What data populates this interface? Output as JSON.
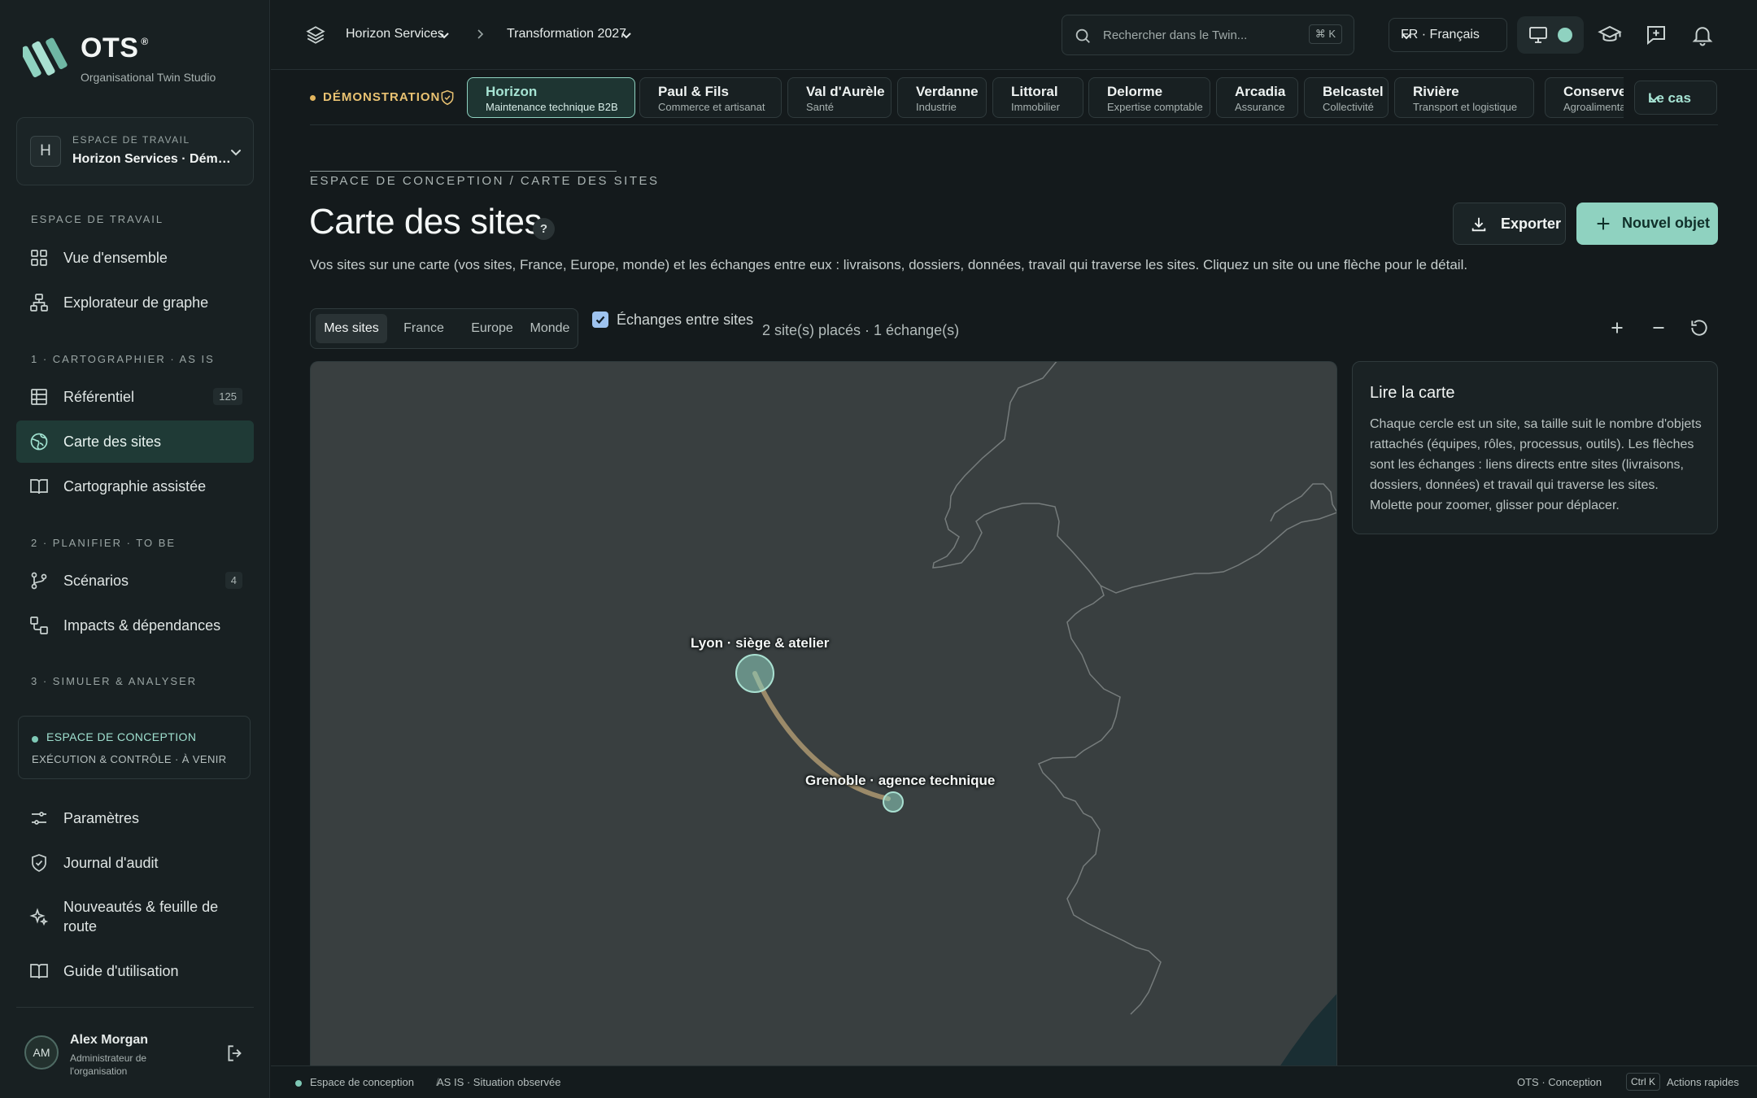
{
  "app": {
    "name": "OTS",
    "registered": "®",
    "subtitle": "Organisational Twin Studio"
  },
  "workspace": {
    "initial": "H",
    "label": "ESPACE DE TRAVAIL",
    "name": "Horizon Services · Démonstration"
  },
  "sidebar": {
    "sections": [
      "ESPACE DE TRAVAIL",
      "1 · CARTOGRAPHIER · AS IS",
      "2 · PLANIFIER · TO BE",
      "3 · SIMULER & ANALYSER"
    ],
    "items": [
      {
        "label": "Vue d'ensemble",
        "icon": "grid-icon"
      },
      {
        "label": "Explorateur de graphe",
        "icon": "graph-icon"
      },
      {
        "label": "Référentiel",
        "icon": "table-icon",
        "badge": "125"
      },
      {
        "label": "Carte des sites",
        "icon": "globe-icon",
        "active": true
      },
      {
        "label": "Cartographie assistée",
        "icon": "book-icon"
      },
      {
        "label": "Scénarios",
        "icon": "branch-icon",
        "badge": "4"
      },
      {
        "label": "Impacts & dépendances",
        "icon": "dependency-icon"
      },
      {
        "label": "Paramètres",
        "icon": "sliders-icon"
      },
      {
        "label": "Journal d'audit",
        "icon": "shield-icon"
      },
      {
        "label": "Nouveautés & feuille de route",
        "icon": "sparkle-icon"
      },
      {
        "label": "Guide d'utilisation",
        "icon": "book-icon"
      }
    ],
    "concept_box": {
      "title": "ESPACE DE CONCEPTION",
      "subtitle": "EXÉCUTION & CONTRÔLE · À VENIR"
    }
  },
  "user": {
    "initials": "AM",
    "name": "Alex Morgan",
    "role": "Administrateur de l'organisation"
  },
  "topbar": {
    "crumb1": "Horizon Services",
    "crumb2": "Transformation 2027",
    "search_placeholder": "Rechercher dans le Twin...",
    "search_shortcut": "⌘ K",
    "language": "FR · Français"
  },
  "demo": {
    "label": "DÉMONSTRATION"
  },
  "cases": [
    {
      "name": "Horizon",
      "sub": "Maintenance technique B2B",
      "active": true
    },
    {
      "name": "Paul & Fils",
      "sub": "Commerce et artisanat"
    },
    {
      "name": "Val d'Aurèle",
      "sub": "Santé"
    },
    {
      "name": "Verdanne",
      "sub": "Industrie"
    },
    {
      "name": "Littoral",
      "sub": "Immobilier"
    },
    {
      "name": "Delorme",
      "sub": "Expertise comptable"
    },
    {
      "name": "Arcadia",
      "sub": "Assurance"
    },
    {
      "name": "Belcastel",
      "sub": "Collectivité"
    },
    {
      "name": "Rivière",
      "sub": "Transport et logistique"
    },
    {
      "name": "Conserverie",
      "sub": "Agroalimentaire"
    }
  ],
  "cases_more": "Le cas",
  "page": {
    "kicker": "ESPACE DE CONCEPTION / CARTE DES SITES",
    "title": "Carte des sites",
    "help": "?",
    "description": "Vos sites sur une carte (vos sites, France, Europe, monde) et les échanges entre eux : livraisons, dossiers, données, travail qui traverse les sites. Cliquez un site ou une flèche pour le détail.",
    "export_label": "Exporter",
    "new_label": "Nouvel objet"
  },
  "map_controls": {
    "scopes": [
      {
        "label": "Mes sites",
        "active": true
      },
      {
        "label": "France"
      },
      {
        "label": "Europe"
      },
      {
        "label": "Monde"
      }
    ],
    "exchanges_label": "Échanges entre sites",
    "exchanges_checked": true,
    "count": "2 site(s) placés · 1 échange(s)"
  },
  "map": {
    "sites": [
      {
        "label": "Lyon · siège & atelier"
      },
      {
        "label": "Grenoble · agence technique"
      }
    ],
    "colors": {
      "land": "#393f40",
      "border": "#767c7c",
      "site": "#8fd2c0",
      "exchange": "#a08e6c",
      "water": "#1a2e33"
    }
  },
  "read_card": {
    "title": "Lire la carte",
    "body": "Chaque cercle est un site, sa taille suit le nombre d'objets rattachés (équipes, rôles, processus, outils). Les flèches sont les échanges : liens directs entre sites (livraisons, dossiers, données) et travail qui traverse les sites. Molette pour zoomer, glisser pour déplacer."
  },
  "statusbar": {
    "mode": "Espace de conception",
    "situation": "AS IS · Situation observée",
    "product": "OTS · Conception",
    "shortcut": "Ctrl K",
    "shortcut_label": "Actions rapides"
  }
}
